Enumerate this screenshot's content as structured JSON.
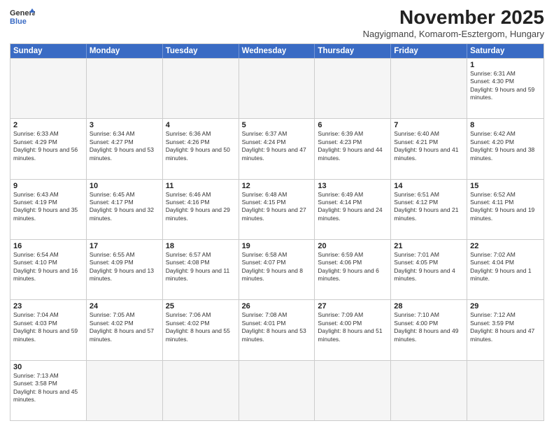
{
  "header": {
    "logo_line1": "General",
    "logo_line2": "Blue",
    "month_year": "November 2025",
    "location": "Nagyigmand, Komarom-Esztergom, Hungary"
  },
  "days_of_week": [
    "Sunday",
    "Monday",
    "Tuesday",
    "Wednesday",
    "Thursday",
    "Friday",
    "Saturday"
  ],
  "rows": [
    [
      {
        "day": "",
        "empty": true
      },
      {
        "day": "",
        "empty": true
      },
      {
        "day": "",
        "empty": true
      },
      {
        "day": "",
        "empty": true
      },
      {
        "day": "",
        "empty": true
      },
      {
        "day": "",
        "empty": true
      },
      {
        "day": "1",
        "sunrise": "6:31 AM",
        "sunset": "4:30 PM",
        "daylight": "9 hours and 59 minutes."
      }
    ],
    [
      {
        "day": "2",
        "sunrise": "6:33 AM",
        "sunset": "4:29 PM",
        "daylight": "9 hours and 56 minutes."
      },
      {
        "day": "3",
        "sunrise": "6:34 AM",
        "sunset": "4:27 PM",
        "daylight": "9 hours and 53 minutes."
      },
      {
        "day": "4",
        "sunrise": "6:36 AM",
        "sunset": "4:26 PM",
        "daylight": "9 hours and 50 minutes."
      },
      {
        "day": "5",
        "sunrise": "6:37 AM",
        "sunset": "4:24 PM",
        "daylight": "9 hours and 47 minutes."
      },
      {
        "day": "6",
        "sunrise": "6:39 AM",
        "sunset": "4:23 PM",
        "daylight": "9 hours and 44 minutes."
      },
      {
        "day": "7",
        "sunrise": "6:40 AM",
        "sunset": "4:21 PM",
        "daylight": "9 hours and 41 minutes."
      },
      {
        "day": "8",
        "sunrise": "6:42 AM",
        "sunset": "4:20 PM",
        "daylight": "9 hours and 38 minutes."
      }
    ],
    [
      {
        "day": "9",
        "sunrise": "6:43 AM",
        "sunset": "4:19 PM",
        "daylight": "9 hours and 35 minutes."
      },
      {
        "day": "10",
        "sunrise": "6:45 AM",
        "sunset": "4:17 PM",
        "daylight": "9 hours and 32 minutes."
      },
      {
        "day": "11",
        "sunrise": "6:46 AM",
        "sunset": "4:16 PM",
        "daylight": "9 hours and 29 minutes."
      },
      {
        "day": "12",
        "sunrise": "6:48 AM",
        "sunset": "4:15 PM",
        "daylight": "9 hours and 27 minutes."
      },
      {
        "day": "13",
        "sunrise": "6:49 AM",
        "sunset": "4:14 PM",
        "daylight": "9 hours and 24 minutes."
      },
      {
        "day": "14",
        "sunrise": "6:51 AM",
        "sunset": "4:12 PM",
        "daylight": "9 hours and 21 minutes."
      },
      {
        "day": "15",
        "sunrise": "6:52 AM",
        "sunset": "4:11 PM",
        "daylight": "9 hours and 19 minutes."
      }
    ],
    [
      {
        "day": "16",
        "sunrise": "6:54 AM",
        "sunset": "4:10 PM",
        "daylight": "9 hours and 16 minutes."
      },
      {
        "day": "17",
        "sunrise": "6:55 AM",
        "sunset": "4:09 PM",
        "daylight": "9 hours and 13 minutes."
      },
      {
        "day": "18",
        "sunrise": "6:57 AM",
        "sunset": "4:08 PM",
        "daylight": "9 hours and 11 minutes."
      },
      {
        "day": "19",
        "sunrise": "6:58 AM",
        "sunset": "4:07 PM",
        "daylight": "9 hours and 8 minutes."
      },
      {
        "day": "20",
        "sunrise": "6:59 AM",
        "sunset": "4:06 PM",
        "daylight": "9 hours and 6 minutes."
      },
      {
        "day": "21",
        "sunrise": "7:01 AM",
        "sunset": "4:05 PM",
        "daylight": "9 hours and 4 minutes."
      },
      {
        "day": "22",
        "sunrise": "7:02 AM",
        "sunset": "4:04 PM",
        "daylight": "9 hours and 1 minute."
      }
    ],
    [
      {
        "day": "23",
        "sunrise": "7:04 AM",
        "sunset": "4:03 PM",
        "daylight": "8 hours and 59 minutes."
      },
      {
        "day": "24",
        "sunrise": "7:05 AM",
        "sunset": "4:02 PM",
        "daylight": "8 hours and 57 minutes."
      },
      {
        "day": "25",
        "sunrise": "7:06 AM",
        "sunset": "4:02 PM",
        "daylight": "8 hours and 55 minutes."
      },
      {
        "day": "26",
        "sunrise": "7:08 AM",
        "sunset": "4:01 PM",
        "daylight": "8 hours and 53 minutes."
      },
      {
        "day": "27",
        "sunrise": "7:09 AM",
        "sunset": "4:00 PM",
        "daylight": "8 hours and 51 minutes."
      },
      {
        "day": "28",
        "sunrise": "7:10 AM",
        "sunset": "4:00 PM",
        "daylight": "8 hours and 49 minutes."
      },
      {
        "day": "29",
        "sunrise": "7:12 AM",
        "sunset": "3:59 PM",
        "daylight": "8 hours and 47 minutes."
      }
    ],
    [
      {
        "day": "30",
        "sunrise": "7:13 AM",
        "sunset": "3:58 PM",
        "daylight": "8 hours and 45 minutes."
      },
      {
        "day": "",
        "empty": true
      },
      {
        "day": "",
        "empty": true
      },
      {
        "day": "",
        "empty": true
      },
      {
        "day": "",
        "empty": true
      },
      {
        "day": "",
        "empty": true
      },
      {
        "day": "",
        "empty": true
      }
    ]
  ]
}
